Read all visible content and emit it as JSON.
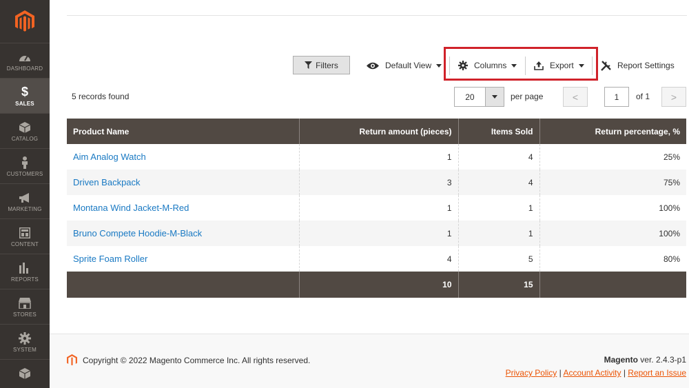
{
  "sidebar": {
    "items": [
      {
        "label": "DASHBOARD",
        "icon": "dashboard-icon"
      },
      {
        "label": "SALES",
        "icon": "dollar-icon",
        "active": true
      },
      {
        "label": "CATALOG",
        "icon": "box-icon"
      },
      {
        "label": "CUSTOMERS",
        "icon": "person-icon"
      },
      {
        "label": "MARKETING",
        "icon": "megaphone-icon"
      },
      {
        "label": "CONTENT",
        "icon": "layout-icon"
      },
      {
        "label": "REPORTS",
        "icon": "bar-chart-icon"
      },
      {
        "label": "STORES",
        "icon": "store-icon"
      },
      {
        "label": "SYSTEM",
        "icon": "gear-icon"
      },
      {
        "label": "",
        "icon": "box-icon"
      }
    ]
  },
  "toolbar": {
    "filters_label": "Filters",
    "view_label": "Default View",
    "columns_label": "Columns",
    "export_label": "Export",
    "report_settings_label": "Report Settings"
  },
  "grid_info": {
    "records_found": "5 records found",
    "per_page_value": "20",
    "per_page_label": "per page",
    "prev": "<",
    "next": ">",
    "page": "1",
    "page_of": "of 1"
  },
  "table": {
    "headers": [
      "Product Name",
      "Return amount (pieces)",
      "Items Sold",
      "Return percentage, %"
    ],
    "rows": [
      {
        "name": "Aim Analog Watch",
        "returns": "1",
        "sold": "4",
        "pct": "25%"
      },
      {
        "name": "Driven Backpack",
        "returns": "3",
        "sold": "4",
        "pct": "75%"
      },
      {
        "name": "Montana Wind Jacket-M-Red",
        "returns": "1",
        "sold": "1",
        "pct": "100%"
      },
      {
        "name": "Bruno Compete Hoodie-M-Black",
        "returns": "1",
        "sold": "1",
        "pct": "100%"
      },
      {
        "name": "Sprite Foam Roller",
        "returns": "4",
        "sold": "5",
        "pct": "80%"
      }
    ],
    "totals": {
      "name": "",
      "returns": "10",
      "sold": "15",
      "pct": ""
    }
  },
  "footer": {
    "copyright": "Copyright © 2022 Magento Commerce Inc. All rights reserved.",
    "brand": "Magento",
    "version": " ver. 2.4.3-p1",
    "links": [
      "Privacy Policy",
      "Account Activity",
      "Report an Issue"
    ]
  },
  "colors": {
    "sidebar_bg": "#373330",
    "header_bg": "#514943",
    "link": "#1979c3",
    "accent": "#eb5202",
    "highlight": "#d0222a"
  }
}
